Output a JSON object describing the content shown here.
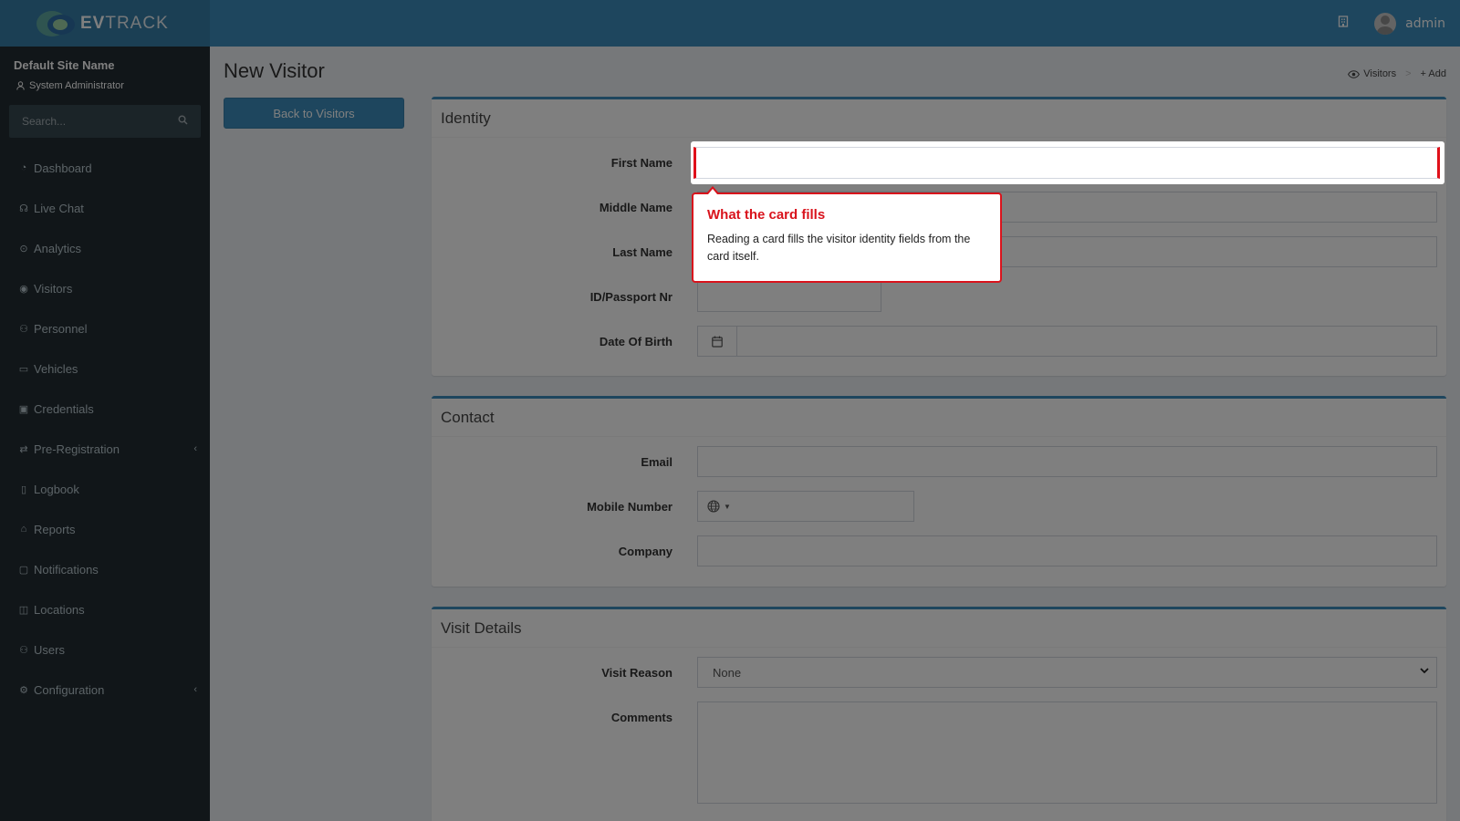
{
  "header": {
    "logo_prefix": "EV",
    "logo_suffix": "TRACK",
    "user_name": "admin",
    "icon_building": "building-icon"
  },
  "sidebar": {
    "site_name": "Default Site Name",
    "role": "System Administrator",
    "search_placeholder": "Search...",
    "items": [
      {
        "label": "Dashboard",
        "icon": "dashboard-icon"
      },
      {
        "label": "Live Chat",
        "icon": "headset-icon"
      },
      {
        "label": "Analytics",
        "icon": "analytics-icon"
      },
      {
        "label": "Visitors",
        "icon": "eye-icon"
      },
      {
        "label": "Personnel",
        "icon": "personnel-icon"
      },
      {
        "label": "Vehicles",
        "icon": "car-icon"
      },
      {
        "label": "Credentials",
        "icon": "id-card-icon"
      },
      {
        "label": "Pre-Registration",
        "icon": "exchange-icon",
        "has_children": true
      },
      {
        "label": "Logbook",
        "icon": "book-icon"
      },
      {
        "label": "Reports",
        "icon": "reports-icon"
      },
      {
        "label": "Notifications",
        "icon": "chat-icon"
      },
      {
        "label": "Locations",
        "icon": "map-icon"
      },
      {
        "label": "Users",
        "icon": "users-icon"
      },
      {
        "label": "Configuration",
        "icon": "gear-icon",
        "has_children": true
      }
    ]
  },
  "page": {
    "title": "New Visitor",
    "back_button": "Back to Visitors",
    "breadcrumb": {
      "visitors": "Visitors",
      "add": "Add"
    }
  },
  "identity": {
    "title": "Identity",
    "first_name": "First Name",
    "middle_name": "Middle Name",
    "last_name": "Last Name",
    "id_passport": "ID/Passport Nr",
    "dob": "Date Of Birth"
  },
  "contact": {
    "title": "Contact",
    "email": "Email",
    "mobile": "Mobile Number",
    "company": "Company"
  },
  "visit": {
    "title": "Visit Details",
    "reason_label": "Visit Reason",
    "reason_value": "None",
    "comments": "Comments"
  },
  "tooltip": {
    "title": "What the card fills",
    "body": "Reading a card fills the visitor identity fields from the card itself."
  },
  "colors": {
    "primary": "#3c8dbc",
    "sidebar_bg": "#222d32",
    "highlight_border": "#e0101a"
  }
}
